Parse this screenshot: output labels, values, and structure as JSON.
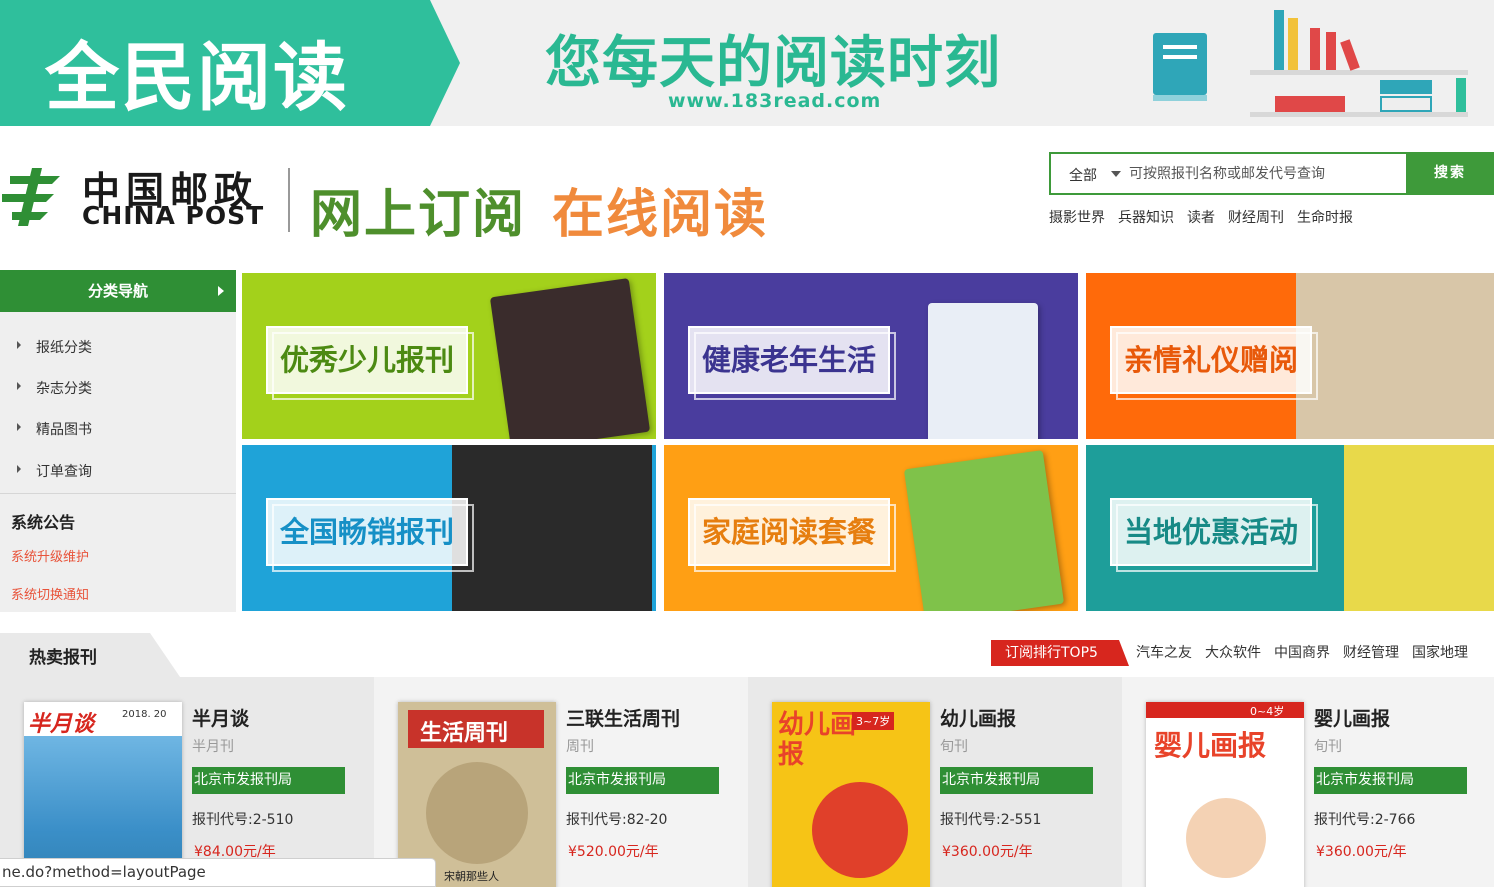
{
  "banner": {
    "title": "全民阅读",
    "slogan": "您每天的阅读时刻",
    "url": "www.183read.com"
  },
  "header": {
    "logo_cn": "中国邮政",
    "logo_en": "CHINA POST",
    "slogan_part1": "网上订阅",
    "slogan_part2": "在线阅读"
  },
  "search": {
    "scope": "全部",
    "placeholder": "可按照报刊名称或邮发代号查询",
    "button": "搜索",
    "hot_keywords": [
      "摄影世界",
      "兵器知识",
      "读者",
      "财经周刊",
      "生命时报"
    ]
  },
  "sidebar": {
    "heading": "分类导航",
    "items": [
      {
        "label": "报纸分类"
      },
      {
        "label": "杂志分类"
      },
      {
        "label": "精品图书"
      },
      {
        "label": "订单查询"
      }
    ],
    "notice_title": "系统公告",
    "notices": [
      "系统升级维护",
      "系统切换通知"
    ]
  },
  "categories": [
    {
      "label": "优秀少儿报刊",
      "bg": "#a3d11b",
      "text_color": "#4c8a12"
    },
    {
      "label": "健康老年生活",
      "bg": "#4a3d9e",
      "text_color": "#3b3490"
    },
    {
      "label": "亲情礼仪赠阅",
      "bg": "#ff6a0a",
      "text_color": "#e8590a"
    },
    {
      "label": "全国畅销报刊",
      "bg": "#1fa3d8",
      "text_color": "#1690c6"
    },
    {
      "label": "家庭阅读套餐",
      "bg": "#ff9f14",
      "text_color": "#e67e0f"
    },
    {
      "label": "当地优惠活动",
      "bg": "#1e9e9a",
      "text_color": "#178a86"
    }
  ],
  "hot": {
    "title": "热卖报刊",
    "rank_button": "订阅排行TOP5",
    "rank_links": [
      "汽车之友",
      "大众软件",
      "中国商界",
      "财经管理",
      "国家地理"
    ]
  },
  "products": [
    {
      "name": "半月谈",
      "frequency": "半月刊",
      "publisher": "北京市发报刊局",
      "code": "报刊代号:2-510",
      "price": "¥84.00元/年",
      "cover_text": "半月谈",
      "cover_sub": "2018. 20"
    },
    {
      "name": "三联生活周刊",
      "frequency": "周刊",
      "publisher": "北京市发报刊局",
      "code": "报刊代号:82-20",
      "price": "¥520.00元/年",
      "cover_text": "生活周刊",
      "cover_sub": "宋朝那些人"
    },
    {
      "name": "幼儿画报",
      "frequency": "旬刊",
      "publisher": "北京市发报刊局",
      "code": "报刊代号:2-551",
      "price": "¥360.00元/年",
      "cover_text": "幼儿画报",
      "cover_sub": "3~7岁"
    },
    {
      "name": "婴儿画报",
      "frequency": "旬刊",
      "publisher": "北京市发报刊局",
      "code": "报刊代号:2-766",
      "price": "¥360.00元/年",
      "cover_text": "婴儿画报",
      "cover_sub": "0~4岁"
    }
  ],
  "status_bar": {
    "url": "ne.do?method=layoutPage"
  }
}
